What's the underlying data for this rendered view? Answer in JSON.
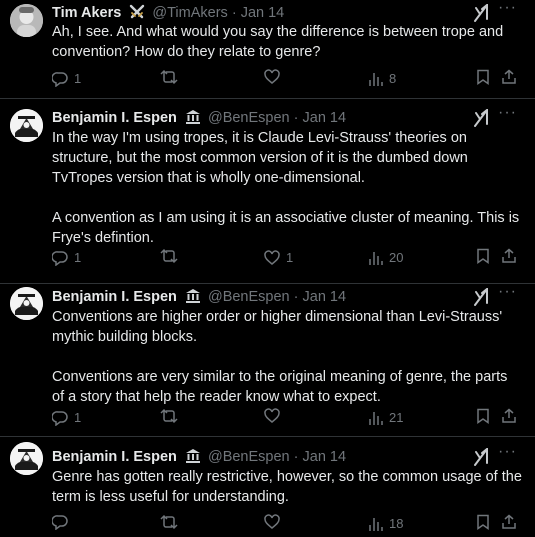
{
  "posts": [
    {
      "name": "Tim Akers",
      "handle": "@TimAkers",
      "dot": "·",
      "date": "Jan 14",
      "paragraphs": [
        "Ah, I see. And what would you say the difference is between trope and convention? How do they relate to genre?"
      ],
      "replies": "1",
      "reposts": "",
      "likes": "",
      "views": "8"
    },
    {
      "name": "Benjamin I. Espen",
      "handle": "@BenEspen",
      "dot": "·",
      "date": "Jan 14",
      "paragraphs": [
        "In the way I'm using tropes, it is Claude Levi-Strauss' theories on structure, but the most common version of it is the dumbed down TvTropes version that is wholly one-dimensional.",
        "A convention as I am using it is an associative cluster of meaning. This is Frye's defintion."
      ],
      "replies": "1",
      "reposts": "",
      "likes": "1",
      "views": "20"
    },
    {
      "name": "Benjamin I. Espen",
      "handle": "@BenEspen",
      "dot": "·",
      "date": "Jan 14",
      "paragraphs": [
        "Conventions are higher order or higher dimensional than Levi-Strauss' mythic building blocks.",
        "Conventions are very similar to the original meaning of genre, the parts of a story that help the reader know what to expect."
      ],
      "replies": "1",
      "reposts": "",
      "likes": "",
      "views": "21"
    },
    {
      "name": "Benjamin I. Espen",
      "handle": "@BenEspen",
      "dot": "·",
      "date": "Jan 14",
      "paragraphs": [
        "Genre has gotten really restrictive, however, so the common usage of the term is less useful for understanding."
      ],
      "replies": "",
      "reposts": "",
      "likes": "",
      "views": "18"
    }
  ],
  "icons": {
    "verified_badge_0": "crossed-swords-icon",
    "verified_badge_other": "institution-building-icon",
    "grok": "grok-icon",
    "more": "more-icon"
  },
  "colors": {
    "background": "#000000",
    "text": "#e7e9ea",
    "muted": "#71767b",
    "separator": "#2f3336"
  }
}
